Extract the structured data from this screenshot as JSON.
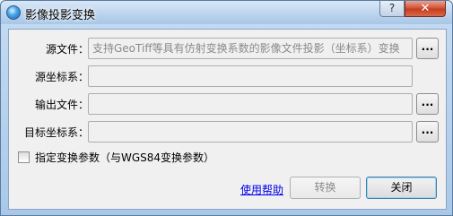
{
  "window": {
    "title": "影像投影变换",
    "help_glyph": "?",
    "close_glyph": "✕"
  },
  "form": {
    "source_file": {
      "label": "源文件：",
      "placeholder": "支持GeoTiff等具有仿射变换系数的影像文件投影（坐标系）变换",
      "browse_label": "..."
    },
    "source_crs": {
      "label": "源坐标系：",
      "value": ""
    },
    "output_file": {
      "label": "输出文件：",
      "value": "",
      "browse_label": "..."
    },
    "target_crs": {
      "label": "目标坐标系：",
      "value": "",
      "browse_label": "..."
    },
    "transform_params_checkbox": {
      "label": "指定变换参数（与WGS84变换参数）",
      "checked": false
    }
  },
  "footer": {
    "help_link": "使用帮助",
    "convert_button": "转换",
    "close_button": "关闭"
  },
  "colors": {
    "link": "#0000ee",
    "disabled_text": "#8d8d8d",
    "title_bar": "#bcd4ee",
    "close_button": "#c43d1f"
  },
  "icons": {
    "app": "globe-icon",
    "help": "question-mark-icon",
    "close": "close-icon"
  }
}
